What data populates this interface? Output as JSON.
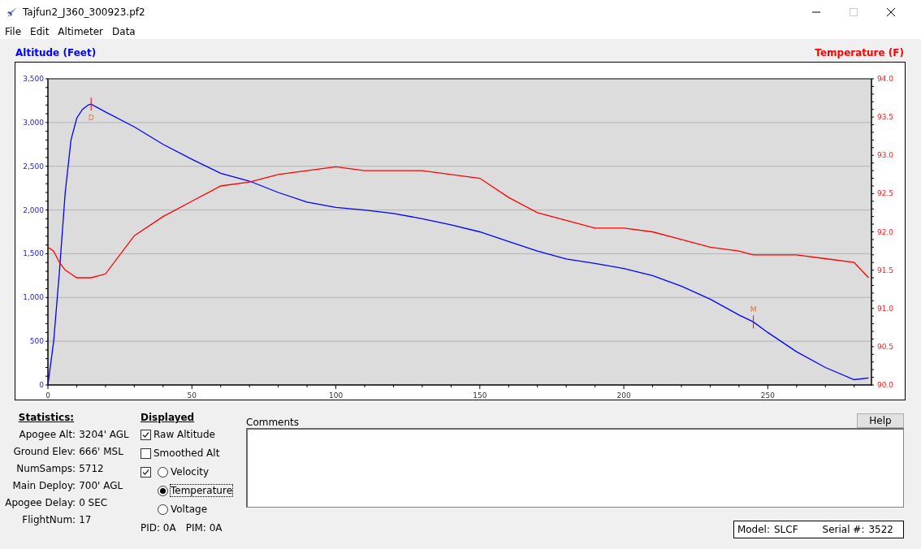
{
  "window": {
    "title": "Tajfun2_J360_300923.pf2"
  },
  "menu": [
    "File",
    "Edit",
    "Altimeter",
    "Data"
  ],
  "chart": {
    "chart_data": {
      "type": "line",
      "ylabel": "Altitude (Feet)",
      "y2label": "Temperature (F)",
      "xlim": [
        0,
        286
      ],
      "ylim": [
        0,
        3500
      ],
      "y2lim": [
        90,
        94
      ],
      "xticks": [
        0,
        50,
        100,
        150,
        200,
        250
      ],
      "yticks": [
        {
          "value": 0,
          "label": "0"
        },
        {
          "value": 500,
          "label": "500"
        },
        {
          "value": 1000,
          "label": "1,000"
        },
        {
          "value": 1500,
          "label": "1,500"
        },
        {
          "value": 2000,
          "label": "2,000"
        },
        {
          "value": 2500,
          "label": "2,500"
        },
        {
          "value": 3000,
          "label": "3,000"
        },
        {
          "value": 3500,
          "label": "3,500"
        }
      ],
      "y2ticks": [
        {
          "value": 90,
          "label": "90.0"
        },
        {
          "value": 90.5,
          "label": "90.5"
        },
        {
          "value": 91,
          "label": "91.0"
        },
        {
          "value": 91.5,
          "label": "91.5"
        },
        {
          "value": 92,
          "label": "92.0"
        },
        {
          "value": 92.5,
          "label": "92.5"
        },
        {
          "value": 93,
          "label": "93.0"
        },
        {
          "value": 93.5,
          "label": "93.5"
        },
        {
          "value": 94,
          "label": "94.0"
        }
      ],
      "x": [
        0,
        2,
        4,
        6,
        8,
        10,
        12,
        14,
        15,
        20,
        30,
        40,
        50,
        60,
        70,
        80,
        90,
        100,
        110,
        120,
        130,
        140,
        150,
        160,
        170,
        180,
        190,
        200,
        210,
        220,
        230,
        240,
        245,
        250,
        260,
        270,
        280,
        285
      ],
      "series": [
        {
          "color": "#0000ff",
          "values": [
            0,
            500,
            1300,
            2200,
            2800,
            3050,
            3150,
            3200,
            3210,
            3120,
            2950,
            2750,
            2580,
            2420,
            2330,
            2200,
            2090,
            2030,
            2000,
            1960,
            1900,
            1830,
            1750,
            1640,
            1530,
            1440,
            1390,
            1330,
            1250,
            1130,
            980,
            800,
            720,
            600,
            380,
            200,
            60,
            80
          ]
        },
        {
          "color": "#ff0000",
          "axis": "y2",
          "values": [
            91.8,
            91.75,
            91.6,
            91.5,
            91.45,
            91.4,
            91.4,
            91.4,
            91.4,
            91.45,
            91.95,
            92.2,
            92.4,
            92.6,
            92.65,
            92.75,
            92.8,
            92.85,
            92.8,
            92.8,
            92.8,
            92.75,
            92.7,
            92.45,
            92.25,
            92.15,
            92.05,
            92.05,
            92.0,
            91.9,
            91.8,
            91.75,
            91.7,
            91.7,
            91.7,
            91.65,
            91.6,
            91.4
          ]
        }
      ],
      "annotations": [
        {
          "x": 15,
          "y": 3210,
          "text": "D"
        },
        {
          "x": 245,
          "y": 720,
          "text": "M"
        }
      ],
      "grid": true
    }
  },
  "statistics": {
    "title": "Statistics:",
    "rows": [
      {
        "label": "Apogee Alt:",
        "value": "3204' AGL"
      },
      {
        "label": "Ground Elev:",
        "value": "666' MSL"
      },
      {
        "label": "NumSamps:",
        "value": "5712"
      },
      {
        "label": "Main Deploy:",
        "value": "700' AGL"
      },
      {
        "label": "Apogee Delay:",
        "value": "0 SEC"
      },
      {
        "label": "FlightNum:",
        "value": "17"
      }
    ]
  },
  "displayed": {
    "title": "Displayed",
    "checkboxes": [
      {
        "label": "Raw Altitude",
        "checked": true
      },
      {
        "label": "Smoothed Alt",
        "checked": false
      }
    ],
    "aux_checkbox": {
      "checked": true
    },
    "radios": [
      {
        "label": "Velocity",
        "selected": false
      },
      {
        "label": "Temperature",
        "selected": true
      },
      {
        "label": "Voltage",
        "selected": false
      }
    ],
    "pid": "PID: 0A",
    "pim": "PIM: 0A"
  },
  "comments": {
    "label": "Comments"
  },
  "help_button": "Help",
  "device": {
    "model_label": "Model:",
    "model": "SLCF",
    "serial_label": "Serial #:",
    "serial": "3522"
  }
}
